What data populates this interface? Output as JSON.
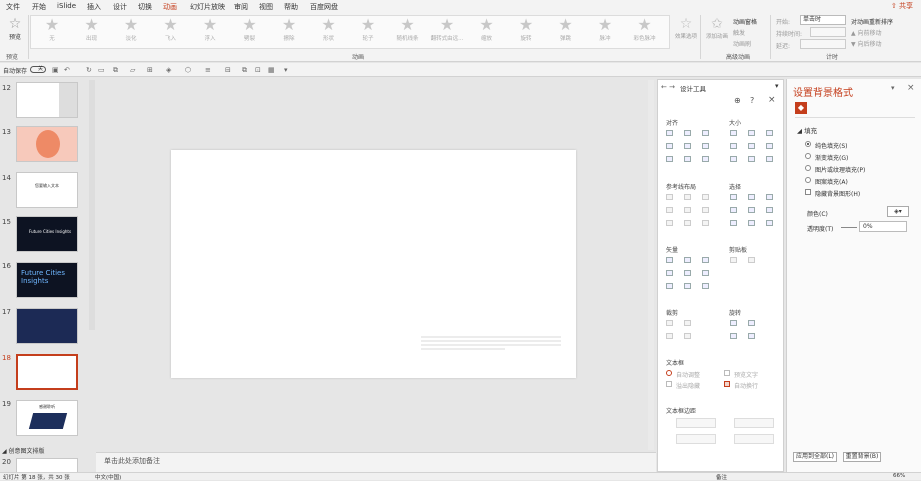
{
  "menubar": {
    "items": [
      "文件",
      "开始",
      "iSlide",
      "插入",
      "设计",
      "切换",
      "动画",
      "幻灯片放映",
      "审阅",
      "视图",
      "帮助",
      "百度网盘"
    ],
    "active": "动画",
    "share": "共享"
  },
  "ribbon": {
    "preview_label": "预览",
    "preview_group": "预览",
    "effects": [
      "无",
      "出现",
      "淡化",
      "飞入",
      "浮入",
      "劈裂",
      "擦除",
      "形状",
      "轮子",
      "随机线条",
      "翻转式由远...",
      "缩放",
      "旋转",
      "弹跳",
      "脉冲",
      "彩色脉冲"
    ],
    "animation_group": "动画",
    "effect_options": "效果选项",
    "add_animation": "添加动画",
    "animation_pane": "动画窗格",
    "trigger": "触发",
    "painter": "动画刷",
    "advanced_group": "高级动画",
    "start_label": "开始:",
    "start_value": "单击时",
    "duration_label": "持续时间:",
    "delay_label": "延迟:",
    "reorder": "对动画重新排序",
    "move_earlier": "向前移动",
    "move_later": "向后移动",
    "timing_group": "计时"
  },
  "qat": {
    "autosave_label": "自动保存",
    "toggle": "关"
  },
  "thumbnails": [
    {
      "num": "12"
    },
    {
      "num": "13"
    },
    {
      "num": "14",
      "text": "您要输入文本"
    },
    {
      "num": "15",
      "text": "Future Cities Insights"
    },
    {
      "num": "16",
      "text": "Future Cities Insights"
    },
    {
      "num": "17"
    },
    {
      "num": "18"
    },
    {
      "num": "19",
      "text": "感谢聆听"
    }
  ],
  "section_label": "创意图文排版",
  "next_num": "20",
  "notes_placeholder": "单击此处添加备注",
  "status": {
    "slide_info": "幻灯片 第 18 张，共 30 张",
    "lang": "中文(中国)",
    "notes": "备注",
    "zoom": "66%"
  },
  "design_panel": {
    "title": "设计工具",
    "sections": {
      "align": "对齐",
      "size": "大小",
      "guides": "参考线布局",
      "select": "选择",
      "vector": "矢量",
      "clipboard": "剪贴板",
      "crop": "裁剪",
      "rotate": "旋转",
      "textbox": "文本框",
      "textmargin": "文本框边距"
    },
    "textbox_opts": [
      "自动调整",
      "预览文字",
      "溢出隐藏",
      "自动换行"
    ]
  },
  "format_panel": {
    "title": "设置背景格式",
    "fill_section": "填充",
    "options": [
      "纯色填充(S)",
      "渐变填充(G)",
      "图片或纹理填充(P)",
      "图案填充(A)"
    ],
    "hide_bg": "隐藏背景图形(H)",
    "color_label": "颜色(C)",
    "transparency_label": "透明度(T)",
    "transparency_value": "0%",
    "apply_all": "应用到全部(L)",
    "reset": "重置背景(B)"
  },
  "colors": {
    "accent": "#c43e1c",
    "dark_thumb": "#0d1322",
    "ribbon": "#f3f3f3"
  }
}
